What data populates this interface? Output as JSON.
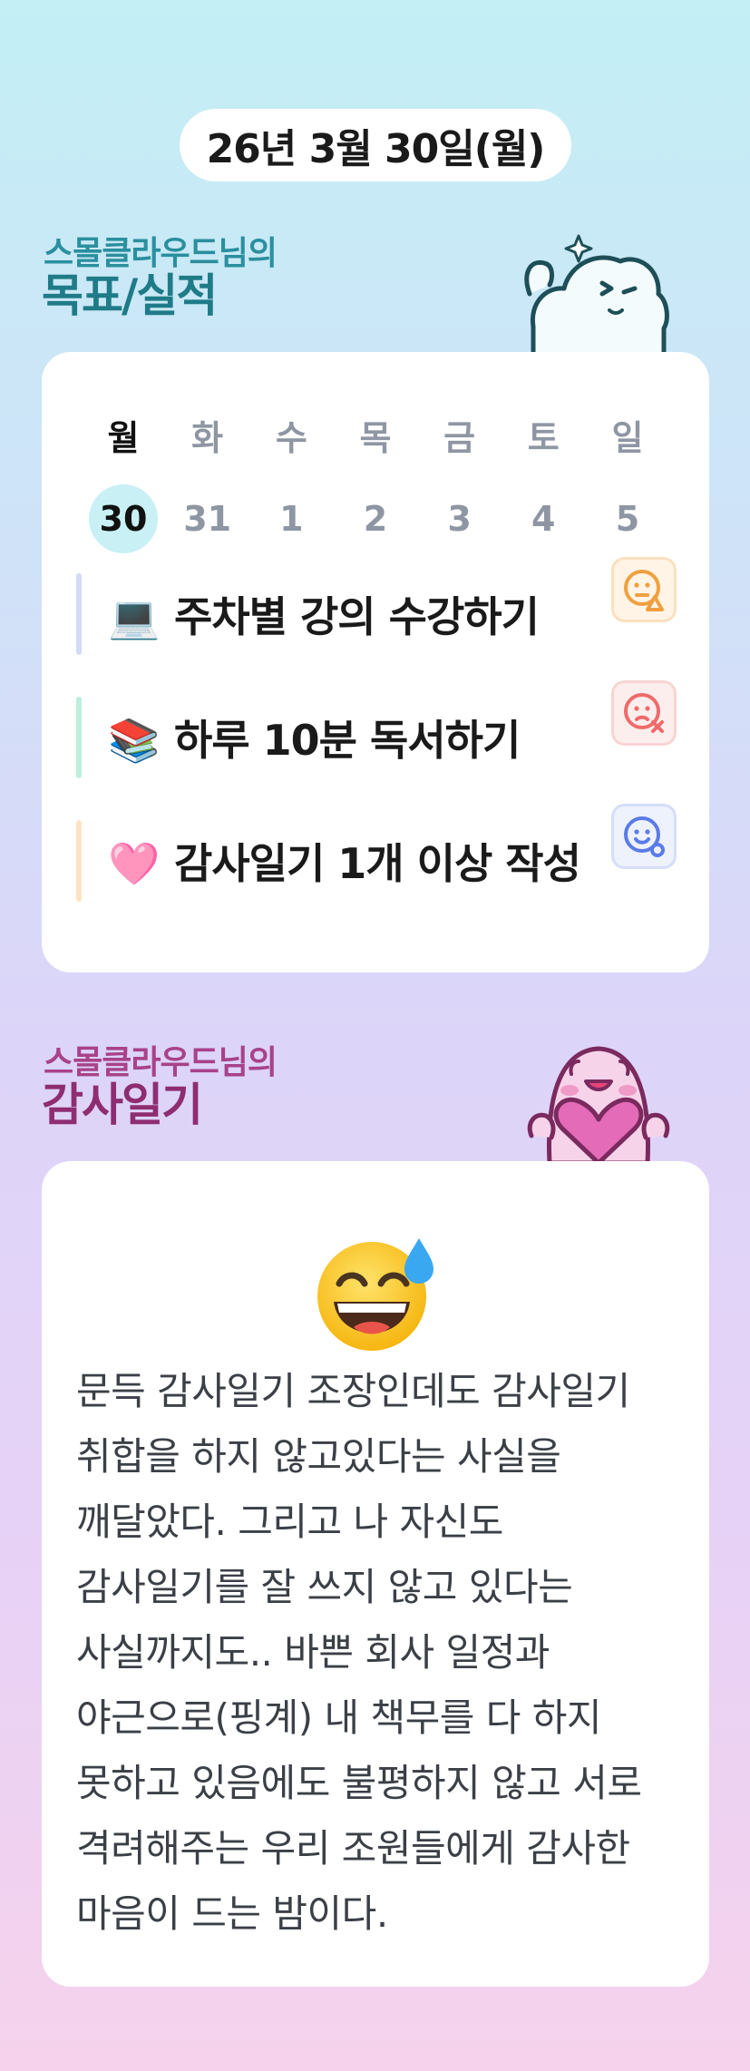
{
  "date": "26년 3월 30일(월)",
  "goals_section": {
    "subtitle": "스몰클라우드님의",
    "title": "목표/실적",
    "subtitle_color": "#2a8f9e",
    "title_color": "#1f7b87"
  },
  "week": [
    {
      "name": "월",
      "num": "30",
      "active": true
    },
    {
      "name": "화",
      "num": "31",
      "active": false
    },
    {
      "name": "수",
      "num": "1",
      "active": false
    },
    {
      "name": "목",
      "num": "2",
      "active": false
    },
    {
      "name": "금",
      "num": "3",
      "active": false
    },
    {
      "name": "토",
      "num": "4",
      "active": false
    },
    {
      "name": "일",
      "num": "5",
      "active": false
    }
  ],
  "goals": [
    {
      "emoji": "💻",
      "label": "주차별 강의 수강하기",
      "bar_color": "#d2dbf8",
      "status_icon": "warning-face-icon",
      "status_color": "#f0a040"
    },
    {
      "emoji": "📚",
      "label": "하루 10분 독서하기",
      "bar_color": "#bcefdc",
      "status_icon": "fail-face-icon",
      "status_color": "#ef6b6b"
    },
    {
      "emoji": "🩷",
      "label": "감사일기 1개 이상 작성",
      "bar_color": "#fde3c2",
      "status_icon": "success-face-icon",
      "status_color": "#5b7be8"
    }
  ],
  "diary_section": {
    "subtitle": "스몰클라우드님의",
    "title": "감사일기",
    "subtitle_color": "#a8428a",
    "title_color": "#8e2d72"
  },
  "diary": {
    "mood_icon": "grinning-sweat-face-icon",
    "text": "문득 감사일기 조장인데도 감사일기 취합을 하지 않고있다는 사실을 깨달았다. 그리고 나 자신도 감사일기를 잘 쓰지 않고 있다는 사실까지도.. 바쁜 회사 일정과 야근으로(핑계) 내 책무를 다 하지 못하고 있음에도 불평하지 않고 서로 격려해주는 우리 조원들에게 감사한 마음이 드는 밤이다."
  }
}
